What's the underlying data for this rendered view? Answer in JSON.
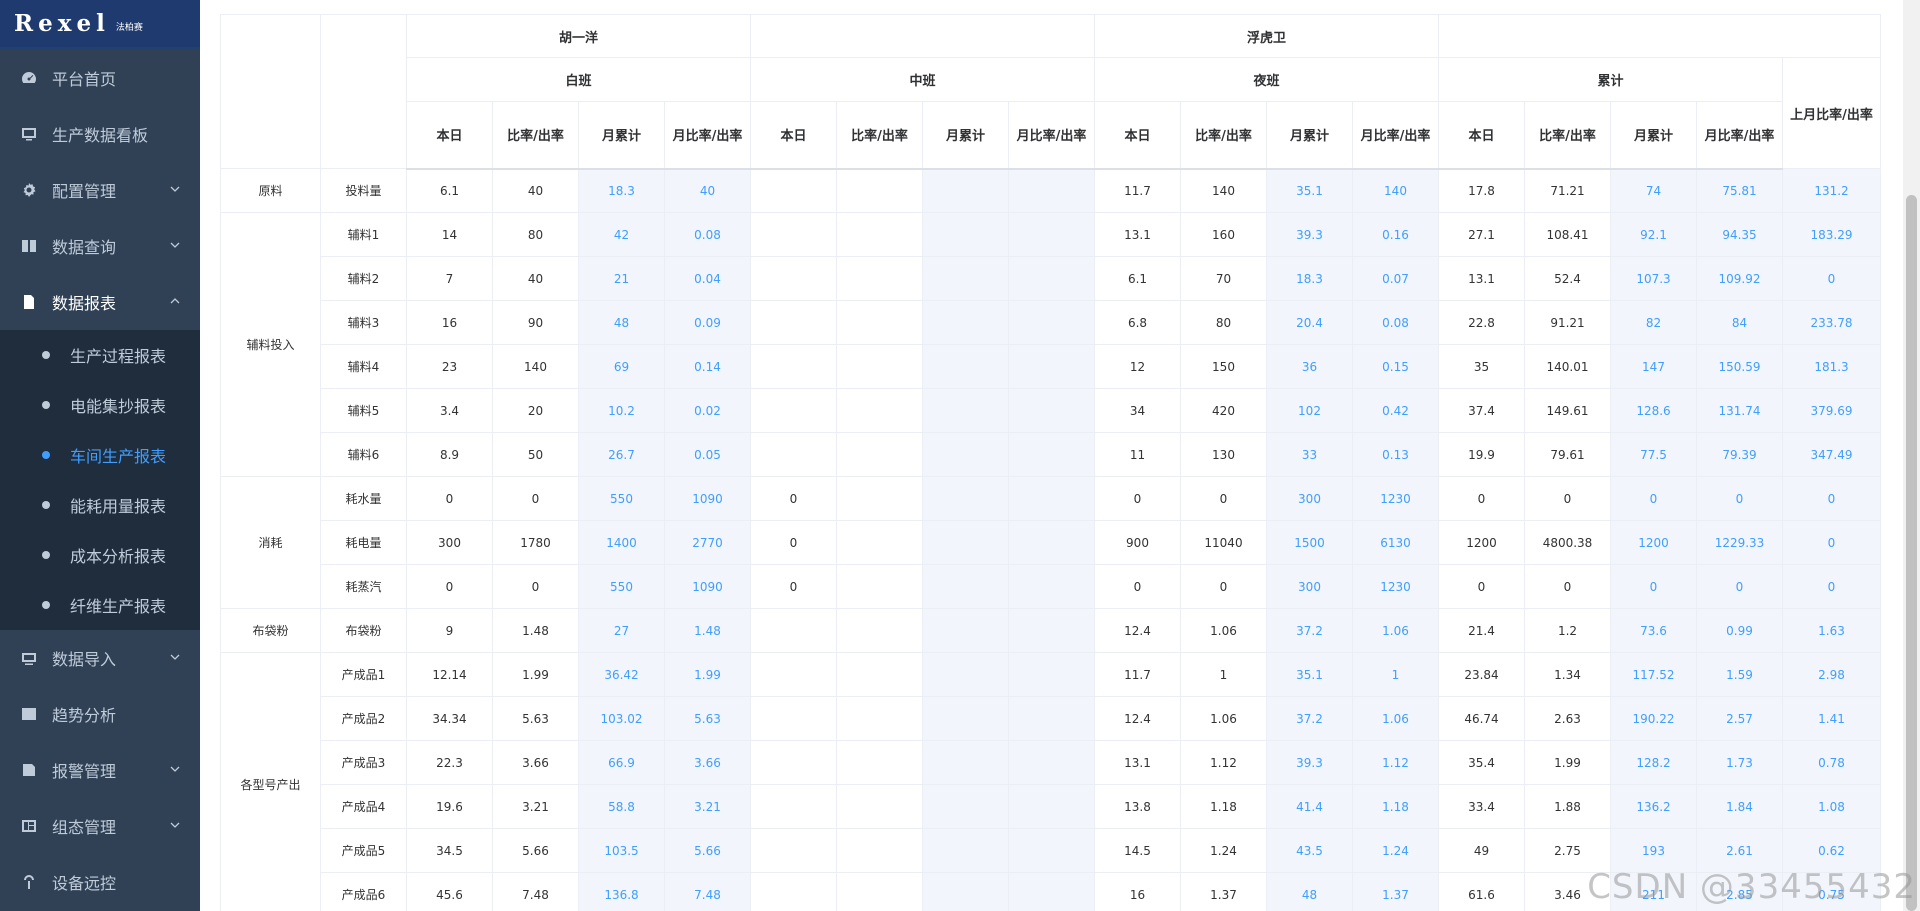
{
  "logo": {
    "main": "Rexel",
    "sub": "法柏赛"
  },
  "sidebar": {
    "items": [
      {
        "label": "平台首页"
      },
      {
        "label": "生产数据看板"
      },
      {
        "label": "配置管理"
      },
      {
        "label": "数据查询"
      },
      {
        "label": "数据报表"
      },
      {
        "label": "数据导入"
      },
      {
        "label": "趋势分析"
      },
      {
        "label": "报警管理"
      },
      {
        "label": "组态管理"
      },
      {
        "label": "设备远控"
      }
    ],
    "subitems": [
      {
        "label": "生产过程报表"
      },
      {
        "label": "电能集抄报表"
      },
      {
        "label": "车间生产报表"
      },
      {
        "label": "能耗用量报表"
      },
      {
        "label": "成本分析报表"
      },
      {
        "label": "纤维生产报表"
      }
    ]
  },
  "table": {
    "row1": [
      "胡一洋",
      "",
      "浮虎卫",
      ""
    ],
    "row2": [
      "白班",
      "中班",
      "夜班",
      "累计",
      "上月比率/出率"
    ],
    "row3": [
      "本日",
      "比率/出率",
      "月累计",
      "月比率/出率",
      "本日",
      "比率/出率",
      "月累计",
      "月比率/出率",
      "本日",
      "比率/出率",
      "月累计",
      "月比率/出率",
      "本日",
      "比率/出率",
      "月累计",
      "月比率/出率"
    ],
    "groups": [
      "原料",
      "辅料投入",
      "消耗",
      "布袋粉",
      "各型号产出"
    ],
    "rows": [
      {
        "name": "投料量",
        "v": [
          "6.1",
          "40",
          "18.3",
          "40",
          "",
          "",
          "",
          "",
          "11.7",
          "140",
          "35.1",
          "140",
          "17.8",
          "71.21",
          "74",
          "75.81",
          "131.2"
        ]
      },
      {
        "name": "辅料1",
        "v": [
          "14",
          "80",
          "42",
          "0.08",
          "",
          "",
          "",
          "",
          "13.1",
          "160",
          "39.3",
          "0.16",
          "27.1",
          "108.41",
          "92.1",
          "94.35",
          "183.29"
        ]
      },
      {
        "name": "辅料2",
        "v": [
          "7",
          "40",
          "21",
          "0.04",
          "",
          "",
          "",
          "",
          "6.1",
          "70",
          "18.3",
          "0.07",
          "13.1",
          "52.4",
          "107.3",
          "109.92",
          "0"
        ]
      },
      {
        "name": "辅料3",
        "v": [
          "16",
          "90",
          "48",
          "0.09",
          "",
          "",
          "",
          "",
          "6.8",
          "80",
          "20.4",
          "0.08",
          "22.8",
          "91.21",
          "82",
          "84",
          "233.78"
        ]
      },
      {
        "name": "辅料4",
        "v": [
          "23",
          "140",
          "69",
          "0.14",
          "",
          "",
          "",
          "",
          "12",
          "150",
          "36",
          "0.15",
          "35",
          "140.01",
          "147",
          "150.59",
          "181.3"
        ]
      },
      {
        "name": "辅料5",
        "v": [
          "3.4",
          "20",
          "10.2",
          "0.02",
          "",
          "",
          "",
          "",
          "34",
          "420",
          "102",
          "0.42",
          "37.4",
          "149.61",
          "128.6",
          "131.74",
          "379.69"
        ]
      },
      {
        "name": "辅料6",
        "v": [
          "8.9",
          "50",
          "26.7",
          "0.05",
          "",
          "",
          "",
          "",
          "11",
          "130",
          "33",
          "0.13",
          "19.9",
          "79.61",
          "77.5",
          "79.39",
          "347.49"
        ]
      },
      {
        "name": "耗水量",
        "v": [
          "0",
          "0",
          "550",
          "1090",
          "0",
          "",
          "",
          "",
          "0",
          "0",
          "300",
          "1230",
          "0",
          "0",
          "0",
          "0",
          "0"
        ]
      },
      {
        "name": "耗电量",
        "v": [
          "300",
          "1780",
          "1400",
          "2770",
          "0",
          "",
          "",
          "",
          "900",
          "11040",
          "1500",
          "6130",
          "1200",
          "4800.38",
          "1200",
          "1229.33",
          "0"
        ]
      },
      {
        "name": "耗蒸汽",
        "v": [
          "0",
          "0",
          "550",
          "1090",
          "0",
          "",
          "",
          "",
          "0",
          "0",
          "300",
          "1230",
          "0",
          "0",
          "0",
          "0",
          "0"
        ]
      },
      {
        "name": "布袋粉",
        "v": [
          "9",
          "1.48",
          "27",
          "1.48",
          "",
          "",
          "",
          "",
          "12.4",
          "1.06",
          "37.2",
          "1.06",
          "21.4",
          "1.2",
          "73.6",
          "0.99",
          "1.63"
        ]
      },
      {
        "name": "产成品1",
        "v": [
          "12.14",
          "1.99",
          "36.42",
          "1.99",
          "",
          "",
          "",
          "",
          "11.7",
          "1",
          "35.1",
          "1",
          "23.84",
          "1.34",
          "117.52",
          "1.59",
          "2.98"
        ]
      },
      {
        "name": "产成品2",
        "v": [
          "34.34",
          "5.63",
          "103.02",
          "5.63",
          "",
          "",
          "",
          "",
          "12.4",
          "1.06",
          "37.2",
          "1.06",
          "46.74",
          "2.63",
          "190.22",
          "2.57",
          "1.41"
        ]
      },
      {
        "name": "产成品3",
        "v": [
          "22.3",
          "3.66",
          "66.9",
          "3.66",
          "",
          "",
          "",
          "",
          "13.1",
          "1.12",
          "39.3",
          "1.12",
          "35.4",
          "1.99",
          "128.2",
          "1.73",
          "0.78"
        ]
      },
      {
        "name": "产成品4",
        "v": [
          "19.6",
          "3.21",
          "58.8",
          "3.21",
          "",
          "",
          "",
          "",
          "13.8",
          "1.18",
          "41.4",
          "1.18",
          "33.4",
          "1.88",
          "136.2",
          "1.84",
          "1.08"
        ]
      },
      {
        "name": "产成品5",
        "v": [
          "34.5",
          "5.66",
          "103.5",
          "5.66",
          "",
          "",
          "",
          "",
          "14.5",
          "1.24",
          "43.5",
          "1.24",
          "49",
          "2.75",
          "193",
          "2.61",
          "0.62"
        ]
      },
      {
        "name": "产成品6",
        "v": [
          "45.6",
          "7.48",
          "136.8",
          "7.48",
          "",
          "",
          "",
          "",
          "16",
          "1.37",
          "48",
          "1.37",
          "61.6",
          "3.46",
          "211",
          "2.85",
          "0.75"
        ]
      }
    ]
  },
  "watermark": "CSDN @33455432"
}
